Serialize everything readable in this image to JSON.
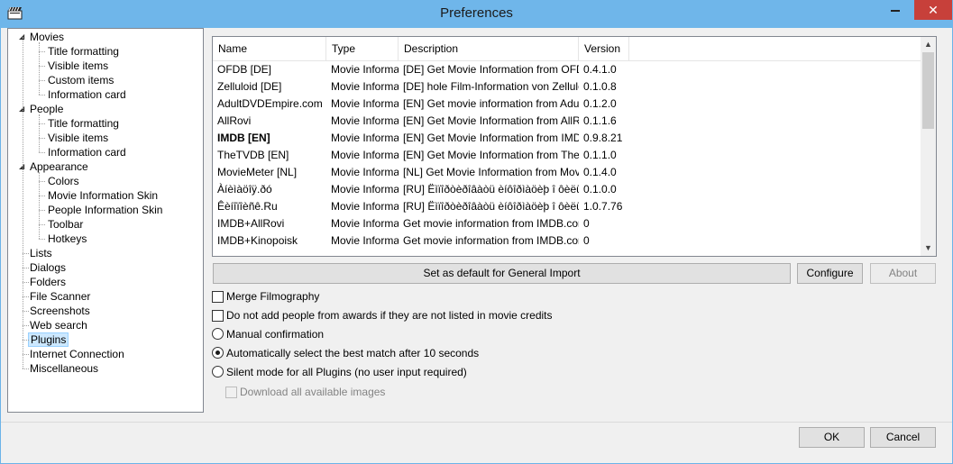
{
  "window": {
    "title": "Preferences",
    "close_glyph": "✕"
  },
  "tree": {
    "items": [
      {
        "label": "Movies",
        "level": 0,
        "expander": "◢"
      },
      {
        "label": "Title formatting",
        "level": 1
      },
      {
        "label": "Visible items",
        "level": 1
      },
      {
        "label": "Custom items",
        "level": 1
      },
      {
        "label": "Information card",
        "level": 1
      },
      {
        "label": "People",
        "level": 0,
        "expander": "◢"
      },
      {
        "label": "Title formatting",
        "level": 1
      },
      {
        "label": "Visible items",
        "level": 1
      },
      {
        "label": "Information card",
        "level": 1
      },
      {
        "label": "Appearance",
        "level": 0,
        "expander": "◢"
      },
      {
        "label": "Colors",
        "level": 1
      },
      {
        "label": "Movie Information Skin",
        "level": 1
      },
      {
        "label": "People Information Skin",
        "level": 1
      },
      {
        "label": "Toolbar",
        "level": 1
      },
      {
        "label": "Hotkeys",
        "level": 1
      },
      {
        "label": "Lists",
        "level": 0
      },
      {
        "label": "Dialogs",
        "level": 0
      },
      {
        "label": "Folders",
        "level": 0
      },
      {
        "label": "File Scanner",
        "level": 0
      },
      {
        "label": "Screenshots",
        "level": 0
      },
      {
        "label": "Web search",
        "level": 0
      },
      {
        "label": "Plugins",
        "level": 0,
        "selected": true
      },
      {
        "label": "Internet Connection",
        "level": 0
      },
      {
        "label": "Miscellaneous",
        "level": 0
      }
    ]
  },
  "plugins": {
    "columns": [
      "Name",
      "Type",
      "Description",
      "Version"
    ],
    "rows": [
      [
        "OFDB [DE]",
        "Movie Informat",
        "[DE] Get Movie Information from OFDB.d",
        "0.4.1.0"
      ],
      [
        "Zelluloid [DE]",
        "Movie Informat",
        "[DE] hole Film-Information von Zelluloid.",
        "0.1.0.8"
      ],
      [
        "AdultDVDEmpire.com",
        "Movie Informat",
        "[EN] Get movie information from AdultDV",
        "0.1.2.0"
      ],
      [
        "AllRovi",
        "Movie Informat",
        "[EN] Get Movie Information from AllRovi",
        "0.1.1.6"
      ],
      [
        "IMDB [EN]",
        "Movie Informat",
        "[EN] Get Movie Information from IMDB.c",
        "0.9.8.21"
      ],
      [
        "TheTVDB [EN]",
        "Movie Informat",
        "[EN] Get Movie Information from TheTVD",
        "0.1.1.0"
      ],
      [
        "MovieMeter [NL]",
        "Movie Informat",
        "[NL] Get Movie Information from MovieM",
        "0.1.4.0"
      ],
      [
        "Àíèìàöîÿ.ðó",
        "Movie Informat",
        "[RU] Ëìïîðòèðîâàòü èíôîðìàöèþ î ôèëüìå èç",
        "0.1.0.0"
      ],
      [
        "Êèíîïîèñê.Ru",
        "Movie Informat",
        "[RU] Ëìïîðòèðîâàòü èíôîðìàöèþ î ôèëüìå èç",
        "1.0.7.76"
      ],
      [
        "IMDB+AllRovi",
        "Movie Informat",
        "Get movie information from IMDB.com ar",
        "0"
      ],
      [
        "IMDB+Kinopoisk",
        "Movie Informat",
        "Get movie information from IMDB.com ar",
        "0"
      ]
    ],
    "bold_row": 4
  },
  "buttons": {
    "set_default": "Set as default for General Import",
    "configure": "Configure",
    "about": "About",
    "ok": "OK",
    "cancel": "Cancel"
  },
  "options": {
    "merge_filmography": "Merge Filmography",
    "no_award_people": "Do not add people from awards if they are not listed in movie credits",
    "manual_confirmation": "Manual confirmation",
    "auto_select": "Automatically select the best match after 10 seconds",
    "silent_mode": "Silent mode for all Plugins (no user input required)",
    "download_images": "Download all available images",
    "selected_mode": "auto_select"
  }
}
